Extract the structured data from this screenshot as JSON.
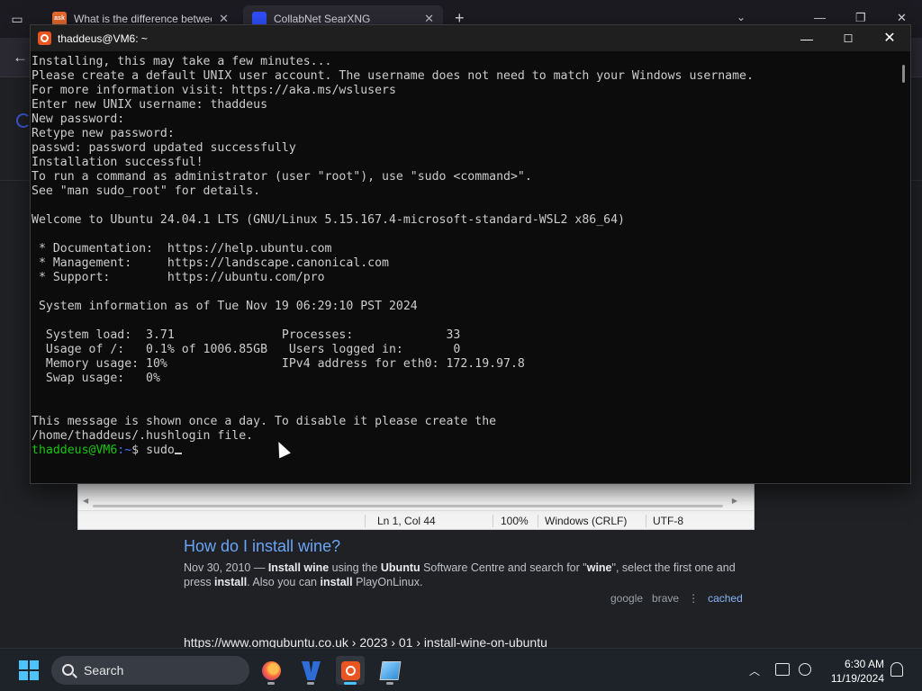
{
  "browser": {
    "tabs": [
      {
        "title": "What is the difference between",
        "favicon": "ask-icon"
      },
      {
        "title": "CollabNet SearXNG",
        "favicon": "searxng-icon"
      }
    ],
    "new_tab": "+",
    "back": "←"
  },
  "terminal": {
    "title": "thaddeus@VM6: ~",
    "lines": [
      "Installing, this may take a few minutes...",
      "Please create a default UNIX user account. The username does not need to match your Windows username.",
      "For more information visit: https://aka.ms/wslusers",
      "Enter new UNIX username: thaddeus",
      "New password:",
      "Retype new password:",
      "passwd: password updated successfully",
      "Installation successful!",
      "To run a command as administrator (user \"root\"), use \"sudo <command>\".",
      "See \"man sudo_root\" for details.",
      "",
      "Welcome to Ubuntu 24.04.1 LTS (GNU/Linux 5.15.167.4-microsoft-standard-WSL2 x86_64)",
      "",
      " * Documentation:  https://help.ubuntu.com",
      " * Management:     https://landscape.canonical.com",
      " * Support:        https://ubuntu.com/pro",
      "",
      " System information as of Tue Nov 19 06:29:10 PST 2024",
      "",
      "  System load:  3.71               Processes:             33",
      "  Usage of /:   0.1% of 1006.85GB   Users logged in:       0",
      "  Memory usage: 10%                IPv4 address for eth0: 172.19.97.8",
      "  Swap usage:   0%",
      "",
      "",
      "This message is shown once a day. To disable it please create the",
      "/home/thaddeus/.hushlogin file."
    ],
    "prompt_user": "thaddeus@VM6",
    "prompt_path": ":~",
    "prompt_symbol": "$ ",
    "command": "sudo"
  },
  "notepad": {
    "position": "Ln 1, Col 44",
    "zoom": "100%",
    "line_ending": "Windows (CRLF)",
    "encoding": "UTF-8"
  },
  "search_result": {
    "title": "How do I install wine?",
    "snippet_date": "Nov 30, 2010 — ",
    "snippet_parts": [
      {
        "t": "Install wine",
        "b": true
      },
      {
        "t": " using the ",
        "b": false
      },
      {
        "t": "Ubuntu",
        "b": true
      },
      {
        "t": " Software Centre and search for \"",
        "b": false
      },
      {
        "t": "wine",
        "b": true
      },
      {
        "t": "\", select the first one and press ",
        "b": false
      },
      {
        "t": "install",
        "b": true
      },
      {
        "t": ". Also you can ",
        "b": false
      },
      {
        "t": "install",
        "b": true
      },
      {
        "t": " PlayOnLinux.",
        "b": false
      }
    ],
    "engines": [
      "google",
      "brave"
    ],
    "separator": "⋮",
    "cached": "cached",
    "next_url": "https://www.omgubuntu.co.uk  › 2023 › 01 › install-wine-on-ubuntu"
  },
  "taskbar": {
    "search_label": "Search",
    "apps": [
      "firefox-icon",
      "virtualbox-icon",
      "ubuntu-icon",
      "notepad-icon"
    ],
    "time": "6:30 AM",
    "date": "11/19/2024"
  }
}
